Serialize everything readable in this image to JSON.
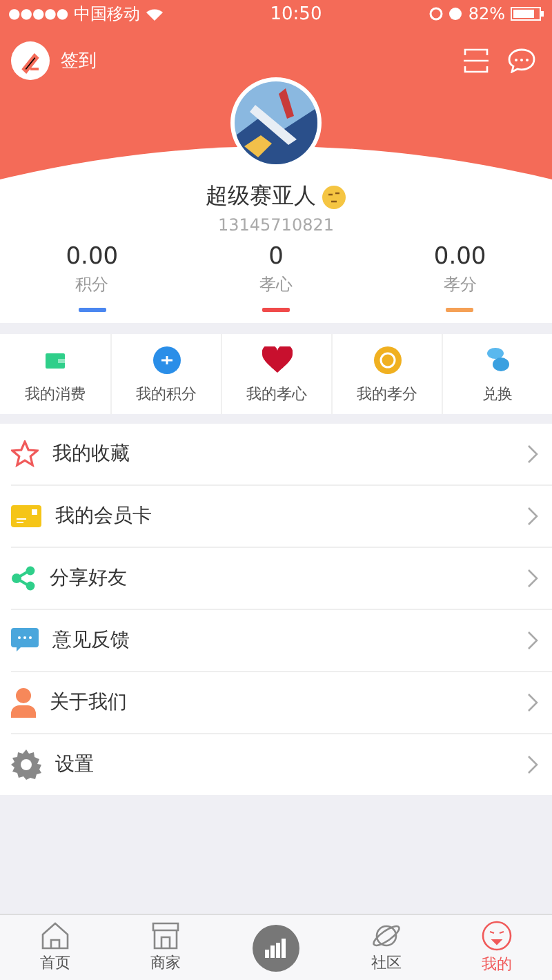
{
  "status_bar": {
    "signal": "●●●●●",
    "carrier": "中国移动",
    "time": "10:50",
    "battery": "82%"
  },
  "header": {
    "checkin": "签到"
  },
  "profile": {
    "name": "超级赛亚人",
    "phone": "13145710821"
  },
  "stats": [
    {
      "value": "0.00",
      "label": "积分",
      "color": "#4a86f0"
    },
    {
      "value": "0",
      "label": "孝心",
      "color": "#f04a4a"
    },
    {
      "value": "0.00",
      "label": "孝分",
      "color": "#f5a055"
    }
  ],
  "quick_actions": [
    {
      "kind": "wallet",
      "label": "我的消费"
    },
    {
      "kind": "points",
      "label": "我的积分"
    },
    {
      "kind": "heart",
      "label": "我的孝心"
    },
    {
      "kind": "coin",
      "label": "我的孝分"
    },
    {
      "kind": "exchange",
      "label": "兑换"
    }
  ],
  "menu": [
    {
      "kind": "star",
      "label": "我的收藏"
    },
    {
      "kind": "card",
      "label": "我的会员卡"
    },
    {
      "kind": "share",
      "label": "分享好友"
    },
    {
      "kind": "feedback",
      "label": "意见反馈"
    },
    {
      "kind": "person",
      "label": "关于我们"
    },
    {
      "kind": "gear",
      "label": "设置"
    }
  ],
  "tab_bar": [
    {
      "kind": "home",
      "label": "首页",
      "selected": false
    },
    {
      "kind": "shop",
      "label": "商家",
      "selected": false
    },
    {
      "kind": "center"
    },
    {
      "kind": "planet",
      "label": "社区",
      "selected": false
    },
    {
      "kind": "me",
      "label": "我的",
      "selected": true
    }
  ]
}
